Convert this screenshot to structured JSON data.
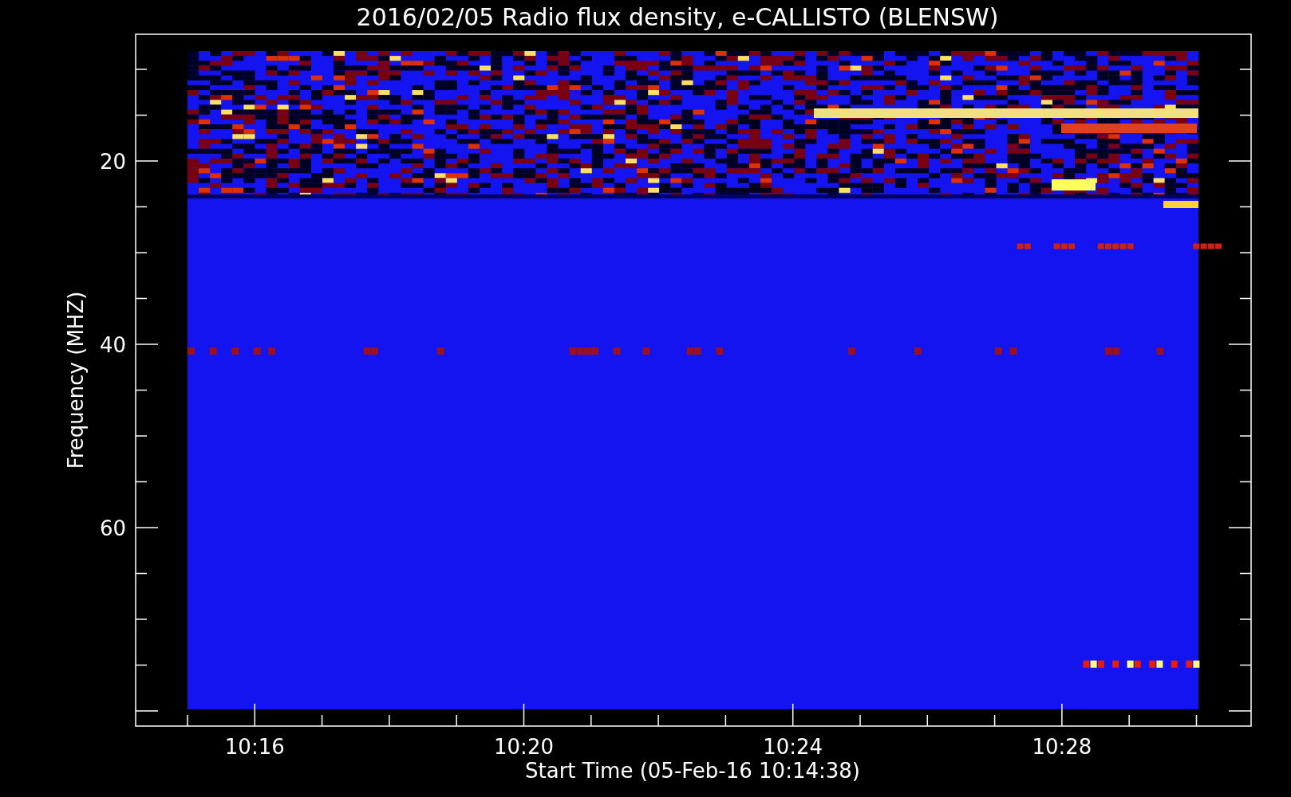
{
  "title": "2016/02/05  Radio flux density, e-CALLISTO (BLENSW)",
  "y_axis": {
    "label": "Frequency (MHZ)",
    "tick_labels": [
      "20",
      "40",
      "60"
    ]
  },
  "x_axis": {
    "label": "Start Time (05-Feb-16 10:14:38)",
    "tick_labels": [
      "10:16",
      "10:20",
      "10:24",
      "10:28"
    ]
  }
}
